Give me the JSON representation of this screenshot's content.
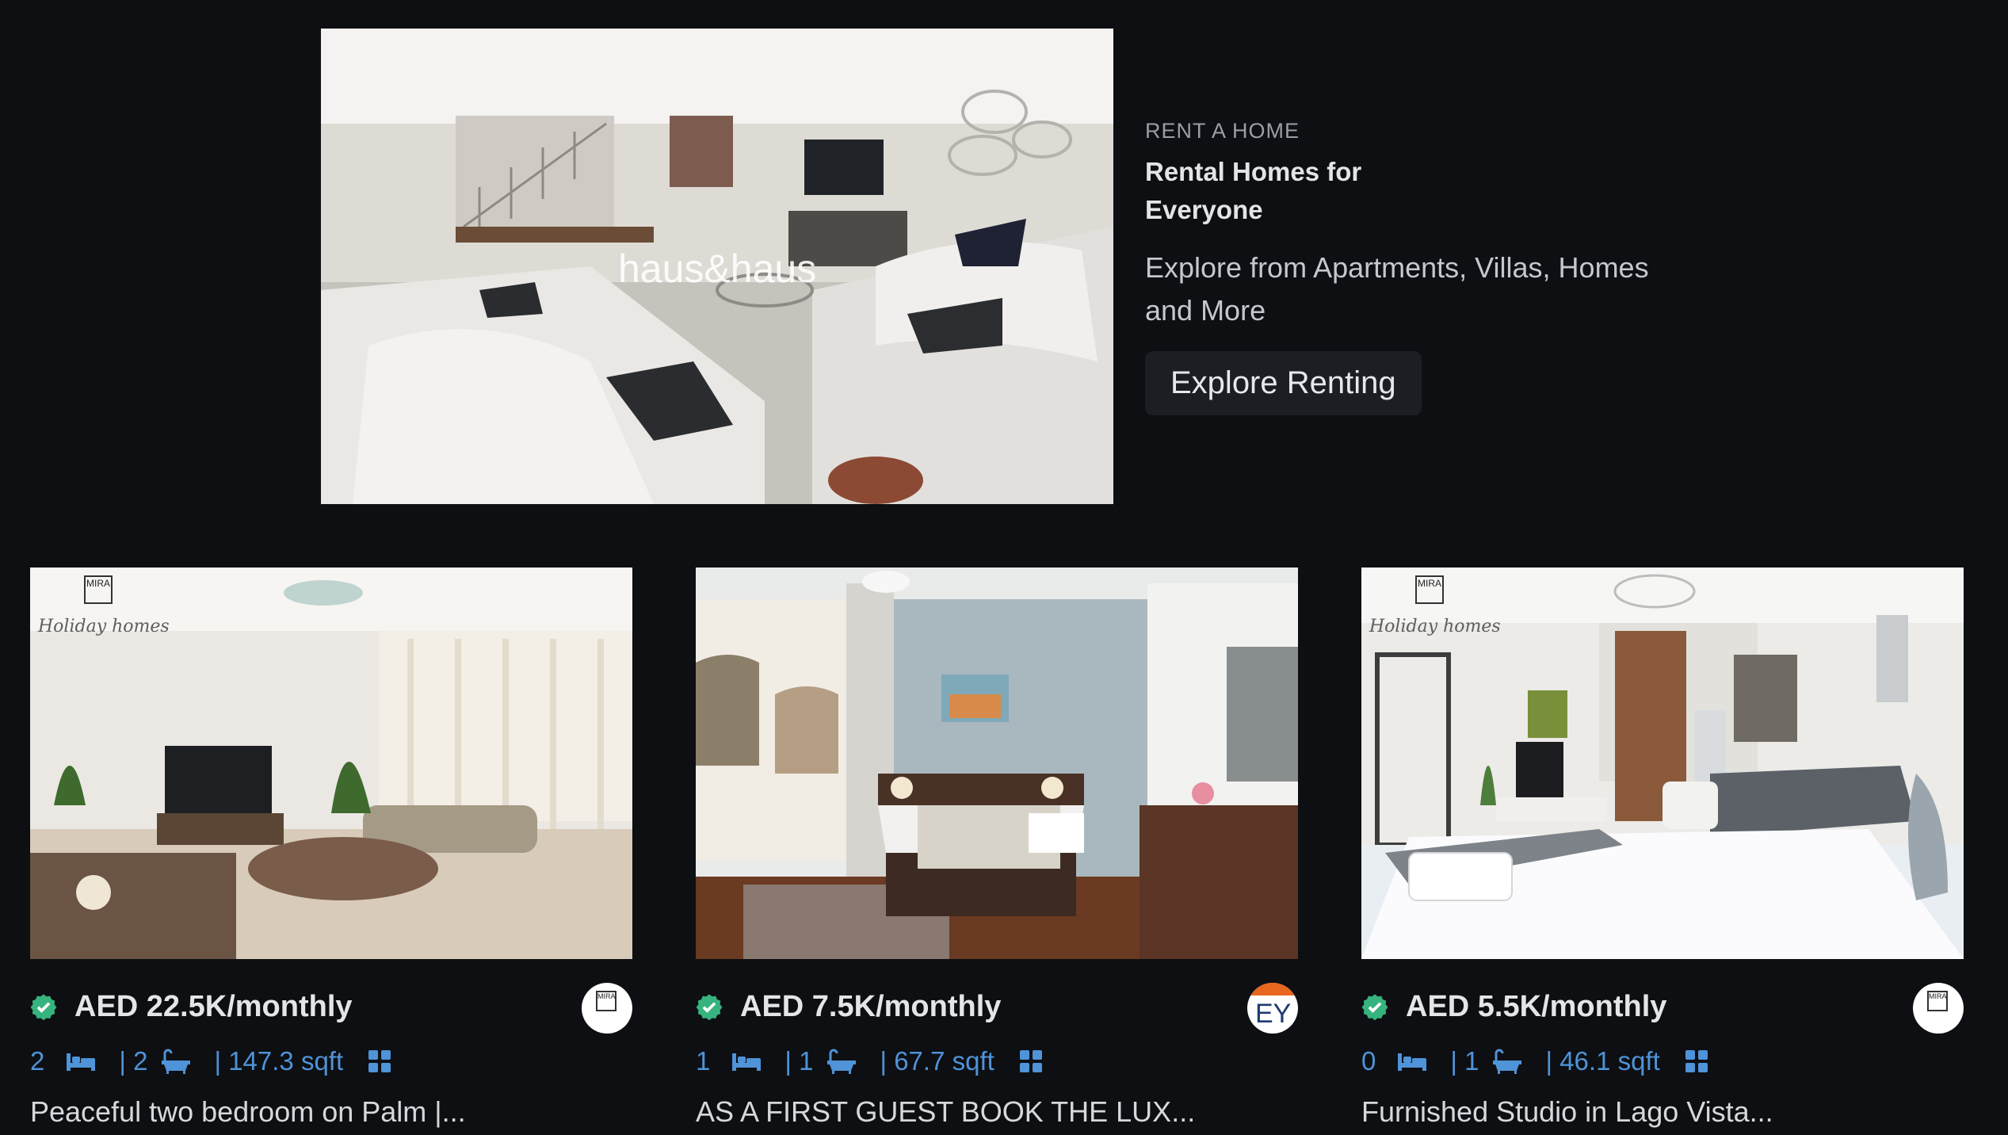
{
  "hero": {
    "image_watermark": "haus&haus",
    "eyebrow": "RENT A HOME",
    "title": "Rental Homes for Everyone",
    "subtitle": "Explore from Apartments, Villas, Homes and More",
    "cta_label": "Explore Renting"
  },
  "listings": [
    {
      "price": "AED 22.5K/monthly",
      "beds": "2",
      "baths": "| 2",
      "area": "| 147.3 sqft",
      "title": "Peaceful two bedroom on Palm |...",
      "photo_brand": "MIRA",
      "photo_caption": "Holiday homes",
      "agency_logo_text": "MIRA"
    },
    {
      "price": "AED 7.5K/monthly",
      "beds": "1",
      "baths": "| 1",
      "area": "| 67.7 sqft",
      "title": "AS A FIRST GUEST BOOK THE LUX...",
      "agency_logo_text": "EY"
    },
    {
      "price": "AED 5.5K/monthly",
      "beds": "0",
      "baths": "| 1",
      "area": "| 46.1 sqft",
      "title": "Furnished Studio in Lago Vista...",
      "photo_brand": "MIRA",
      "photo_caption": "Holiday homes",
      "agency_logo_text": "MIRA"
    }
  ],
  "icons": {
    "verified": "verified-check-icon",
    "bed": "bed-icon",
    "bath": "bathtub-icon",
    "area": "grid-area-icon"
  },
  "colors": {
    "background": "#0d0f12",
    "accent_blue": "#4f93d8",
    "verified_green": "#36b37e"
  }
}
